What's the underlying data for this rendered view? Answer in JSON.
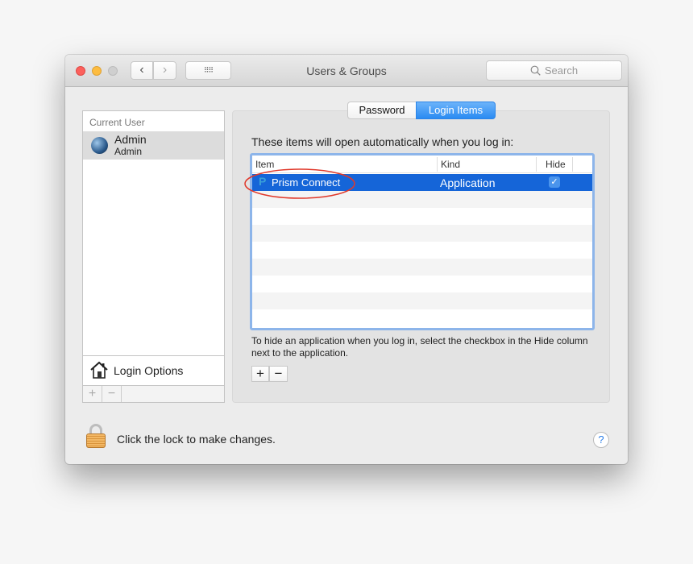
{
  "window": {
    "title": "Users & Groups",
    "search_placeholder": "Search"
  },
  "sidebar": {
    "section": "Current User",
    "user": {
      "name": "Admin",
      "role": "Admin"
    },
    "login_options": "Login Options",
    "add": "+",
    "remove": "−"
  },
  "tabs": [
    {
      "label": "Password",
      "active": false
    },
    {
      "label": "Login Items",
      "active": true
    }
  ],
  "main": {
    "heading": "These items will open automatically when you log in:",
    "columns": [
      "Item",
      "Kind",
      "Hide"
    ],
    "rows": [
      {
        "item": "Prism Connect",
        "kind": "Application",
        "hide": true,
        "selected": true
      }
    ],
    "hint": "To hide an application when you log in, select the checkbox in the Hide column next to the application.",
    "add": "+",
    "remove": "−"
  },
  "footer": {
    "lock_text": "Click the lock to make changes.",
    "help": "?"
  },
  "colors": {
    "selection": "#1565d8",
    "focus": "#8db5ea",
    "annotation": "#e0392b"
  }
}
